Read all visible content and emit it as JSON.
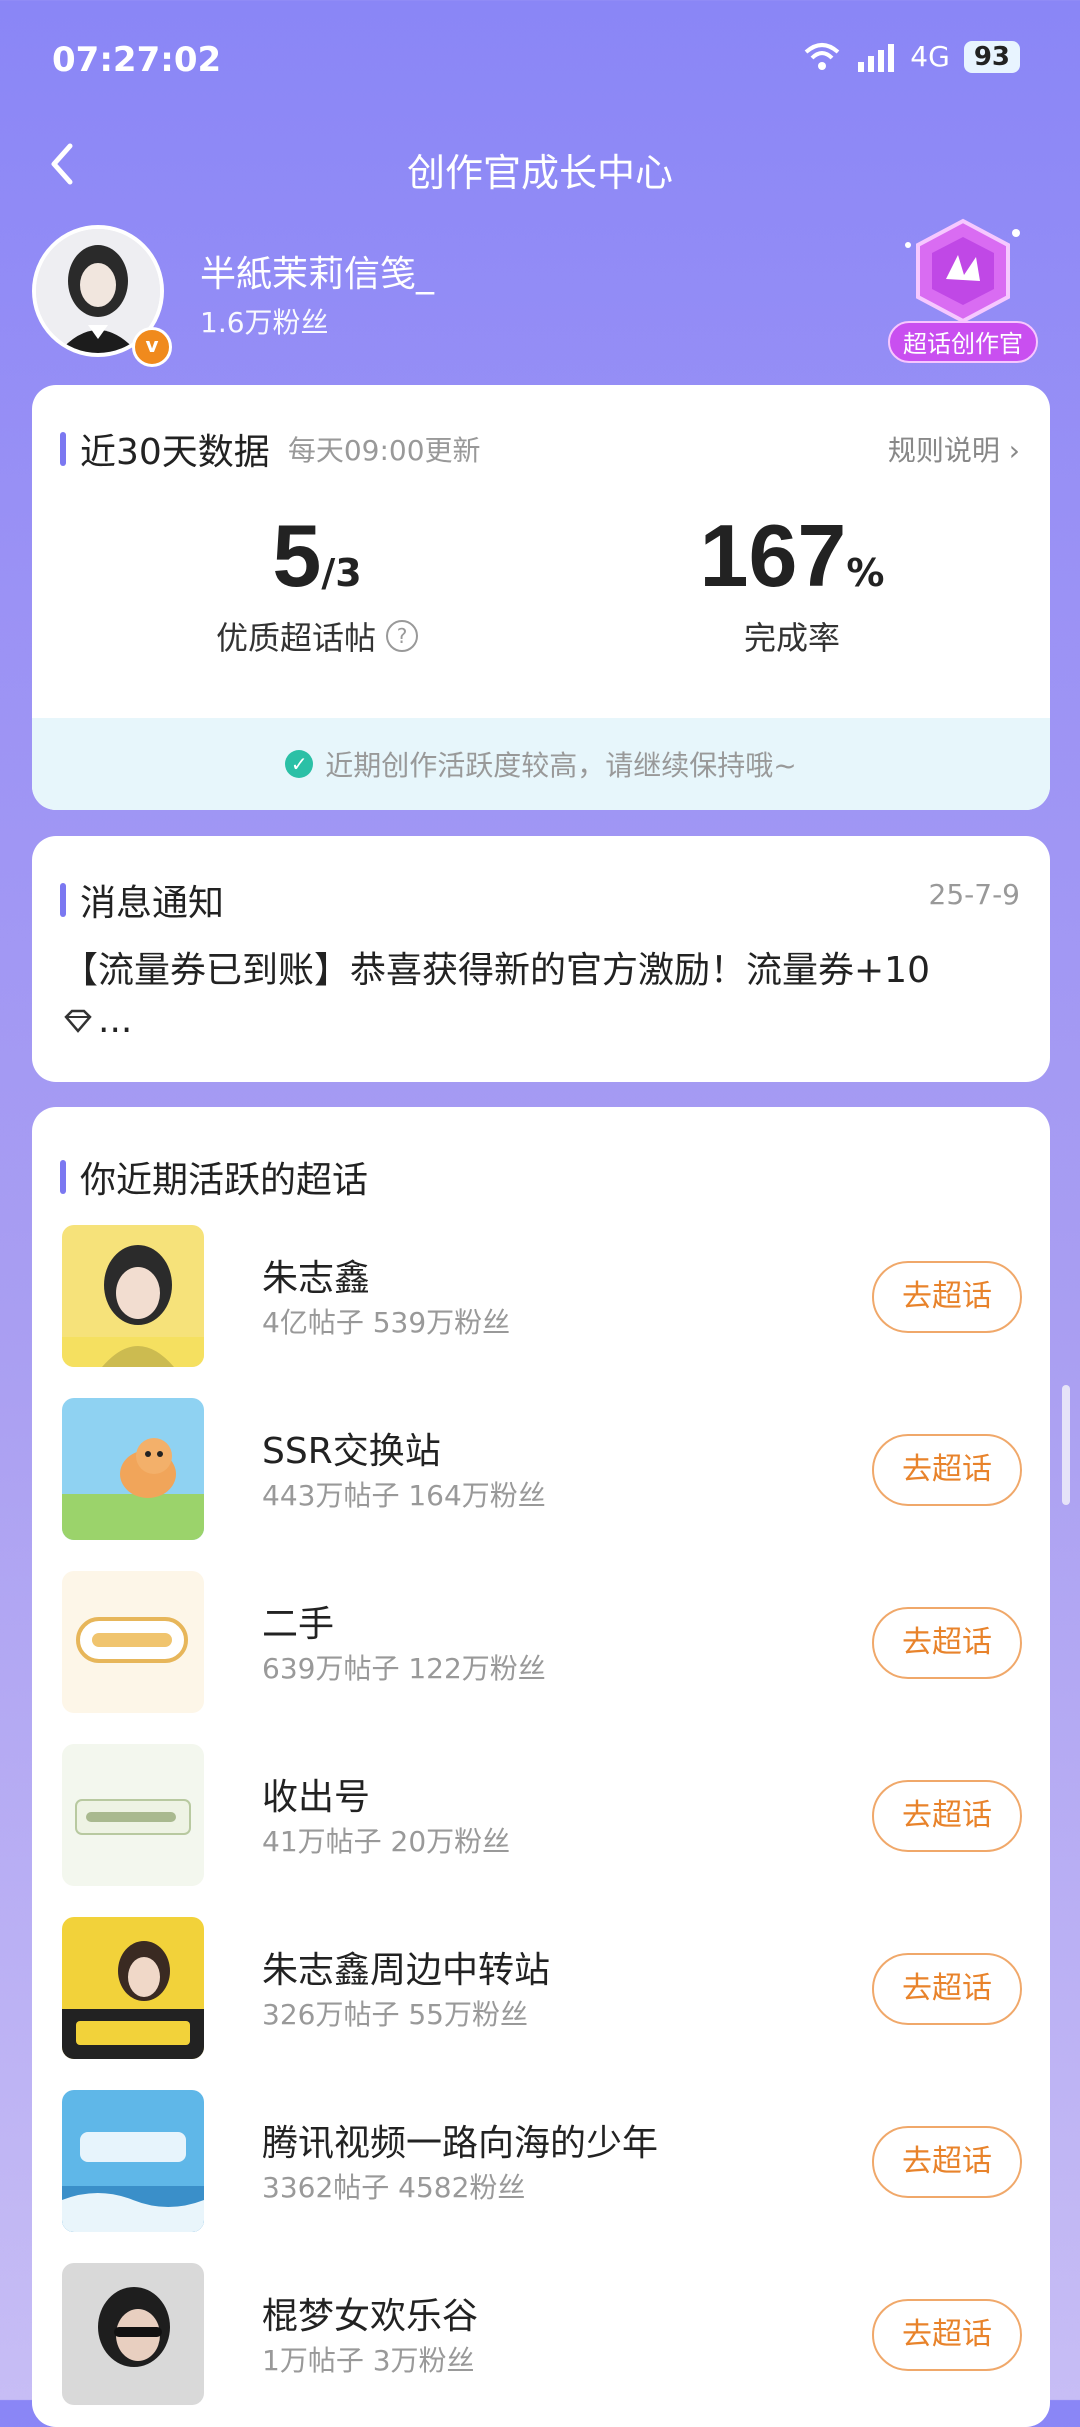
{
  "status": {
    "time": "07:27:02",
    "network": "4G",
    "battery": "93"
  },
  "nav": {
    "title": "创作官成长中心"
  },
  "profile": {
    "name": "半紙茉莉信笺_",
    "fans": "1.6万粉丝",
    "badge_label": "超话创作官",
    "verified_mark": "v"
  },
  "stats_card": {
    "title": "近30天数据",
    "update_note": "每天09:00更新",
    "rules_link": "规则说明 ›",
    "quality_posts": {
      "value": "5",
      "target": "/3",
      "label": "优质超话帖"
    },
    "completion": {
      "value": "167",
      "unit": "%",
      "label": "完成率"
    },
    "tip": "近期创作活跃度较高，请继续保持哦~"
  },
  "message_card": {
    "title": "消息通知",
    "date": "25-7-9",
    "text": "【流量券已到账】恭喜获得新的官方激励！流量券+10",
    "text_tail": "..."
  },
  "topics_card": {
    "title": "你近期活跃的超话",
    "button_label": "去超话",
    "items": [
      {
        "name": "朱志鑫",
        "stats": "4亿帖子 539万粉丝",
        "thumb_color": "#f6e27a"
      },
      {
        "name": "SSR交换站",
        "stats": "443万帖子 164万粉丝",
        "thumb_color": "#8fd2f2"
      },
      {
        "name": "二手",
        "stats": "639万帖子 122万粉丝",
        "thumb_color": "#fdf6e8"
      },
      {
        "name": "收出号",
        "stats": "41万帖子 20万粉丝",
        "thumb_color": "#f3f7ee"
      },
      {
        "name": "朱志鑫周边中转站",
        "stats": "326万帖子 55万粉丝",
        "thumb_color": "#f2d23a"
      },
      {
        "name": "腾讯视频一路向海的少年",
        "stats": "3362帖子 4582粉丝",
        "thumb_color": "#5fb7e8"
      },
      {
        "name": "棍梦女欢乐谷",
        "stats": "1万帖子 3万粉丝",
        "thumb_color": "#d9d9d9"
      }
    ]
  }
}
